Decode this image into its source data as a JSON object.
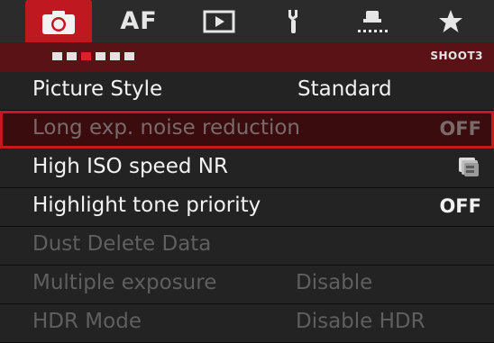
{
  "tabs": {
    "shoot_icon": "camera-icon",
    "af_label": "AF",
    "play_icon": "playback-icon",
    "setup_icon": "wrench-icon",
    "custom_icon": "custom-function-icon",
    "mymenu_icon": "star-icon"
  },
  "subbar": {
    "page_count": 6,
    "active_page": 3,
    "page_label": "SHOOT3"
  },
  "menu": {
    "items": [
      {
        "label": "Picture Style",
        "value": "Standard",
        "state": "enabled"
      },
      {
        "label": "Long exp. noise reduction",
        "value": "OFF",
        "state": "selected"
      },
      {
        "label": "High ISO speed NR",
        "value": "",
        "value_icon": "iso-nr-standard-icon",
        "state": "enabled"
      },
      {
        "label": "Highlight tone priority",
        "value": "OFF",
        "state": "enabled"
      },
      {
        "label": "Dust Delete Data",
        "value": "",
        "state": "disabled"
      },
      {
        "label": "Multiple exposure",
        "value": "Disable",
        "state": "disabled"
      },
      {
        "label": "HDR Mode",
        "value": "Disable HDR",
        "state": "disabled"
      }
    ]
  },
  "colors": {
    "accent_red": "#c01820",
    "subbar_red": "#5a1216",
    "background": "#1c1c1c",
    "text_enabled": "#f2f2f2",
    "text_disabled": "#5f5f5f"
  }
}
